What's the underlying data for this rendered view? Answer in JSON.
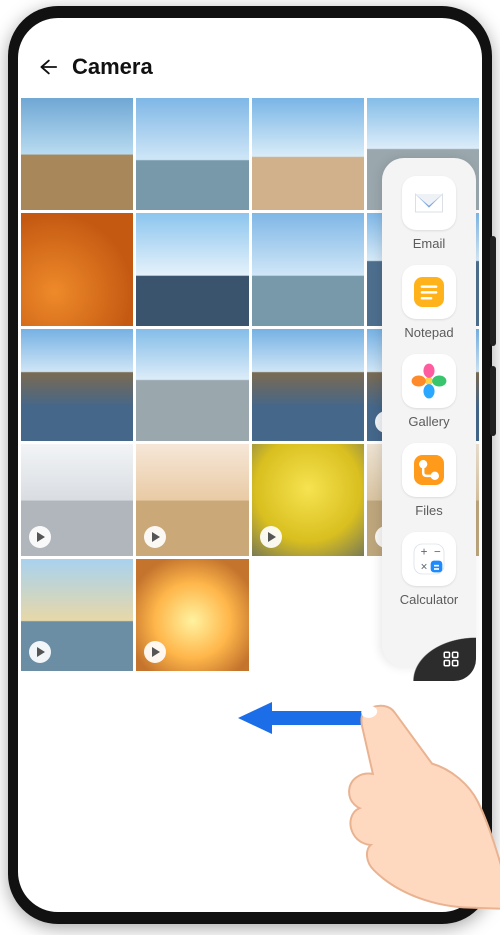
{
  "header": {
    "title": "Camera"
  },
  "grid": {
    "thumbs": [
      {
        "style": "p-ruins",
        "video": false
      },
      {
        "style": "p-sky",
        "video": false
      },
      {
        "style": "p-dome",
        "video": false
      },
      {
        "style": "p-city",
        "video": false
      },
      {
        "style": "p-leaves",
        "video": false
      },
      {
        "style": "p-wheel",
        "video": false
      },
      {
        "style": "p-sky",
        "video": false
      },
      {
        "style": "p-pier",
        "video": false
      },
      {
        "style": "p-canal",
        "video": false
      },
      {
        "style": "p-city",
        "video": false
      },
      {
        "style": "p-canal",
        "video": false
      },
      {
        "style": "p-canal",
        "video": true
      },
      {
        "style": "p-skate",
        "video": true
      },
      {
        "style": "p-gift",
        "video": true
      },
      {
        "style": "p-flowers",
        "video": true
      },
      {
        "style": "p-women",
        "video": true
      },
      {
        "style": "p-beach",
        "video": true
      },
      {
        "style": "p-sunset",
        "video": true
      }
    ]
  },
  "dock": {
    "items": [
      {
        "id": "email",
        "label": "Email"
      },
      {
        "id": "notepad",
        "label": "Notepad"
      },
      {
        "id": "gallery",
        "label": "Gallery"
      },
      {
        "id": "files",
        "label": "Files"
      },
      {
        "id": "calculator",
        "label": "Calculator"
      }
    ]
  }
}
